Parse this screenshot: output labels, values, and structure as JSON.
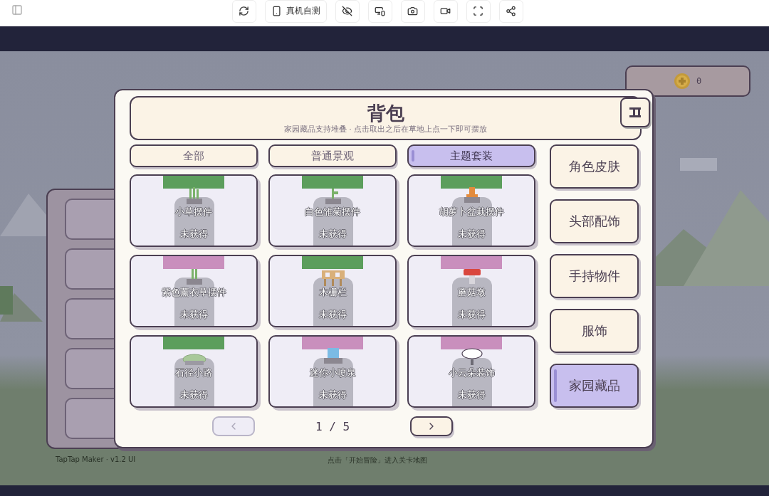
{
  "toolbar": {
    "device_test": "真机自测"
  },
  "coins": {
    "count": "0"
  },
  "backpack": {
    "title": "背包",
    "subtitle": "家园藏品支持堆叠 · 点击取出之后在草地上点一下即可摆放",
    "tabs": [
      {
        "label": "全部",
        "selected": false
      },
      {
        "label": "普通景观",
        "selected": false
      },
      {
        "label": "主题套装",
        "selected": true
      }
    ],
    "items": [
      {
        "name": "小草摆件",
        "status": "未获得",
        "color": "#5c9e5c"
      },
      {
        "name": "白色雏菊摆件",
        "status": "未获得",
        "color": "#5c9e5c"
      },
      {
        "name": "胡萝卜盆栽摆件",
        "status": "未获得",
        "color": "#5c9e5c"
      },
      {
        "name": "紫色薰衣草摆件",
        "status": "未获得",
        "color": "#c98fbd"
      },
      {
        "name": "木栅栏",
        "status": "未获得",
        "color": "#5c9e5c"
      },
      {
        "name": "蘑菇墩",
        "status": "未获得",
        "color": "#c98fbd"
      },
      {
        "name": "石径小路",
        "status": "未获得",
        "color": "#5c9e5c"
      },
      {
        "name": "迷你小喷泉",
        "status": "未获得",
        "color": "#c98fbd"
      },
      {
        "name": "小云朵装饰",
        "status": "未获得",
        "color": "#c98fbd"
      }
    ],
    "categories": [
      {
        "label": "角色皮肤",
        "selected": false
      },
      {
        "label": "头部配饰",
        "selected": false
      },
      {
        "label": "手持物件",
        "selected": false
      },
      {
        "label": "服饰",
        "selected": false
      },
      {
        "label": "家园藏品",
        "selected": true
      }
    ],
    "pagination": {
      "page": "1 / 5",
      "prev_disabled": true
    }
  },
  "footer": {
    "version": "TapTap Maker · v1.2 UI",
    "hint": "点击「开始冒险」进入关卡地图"
  }
}
